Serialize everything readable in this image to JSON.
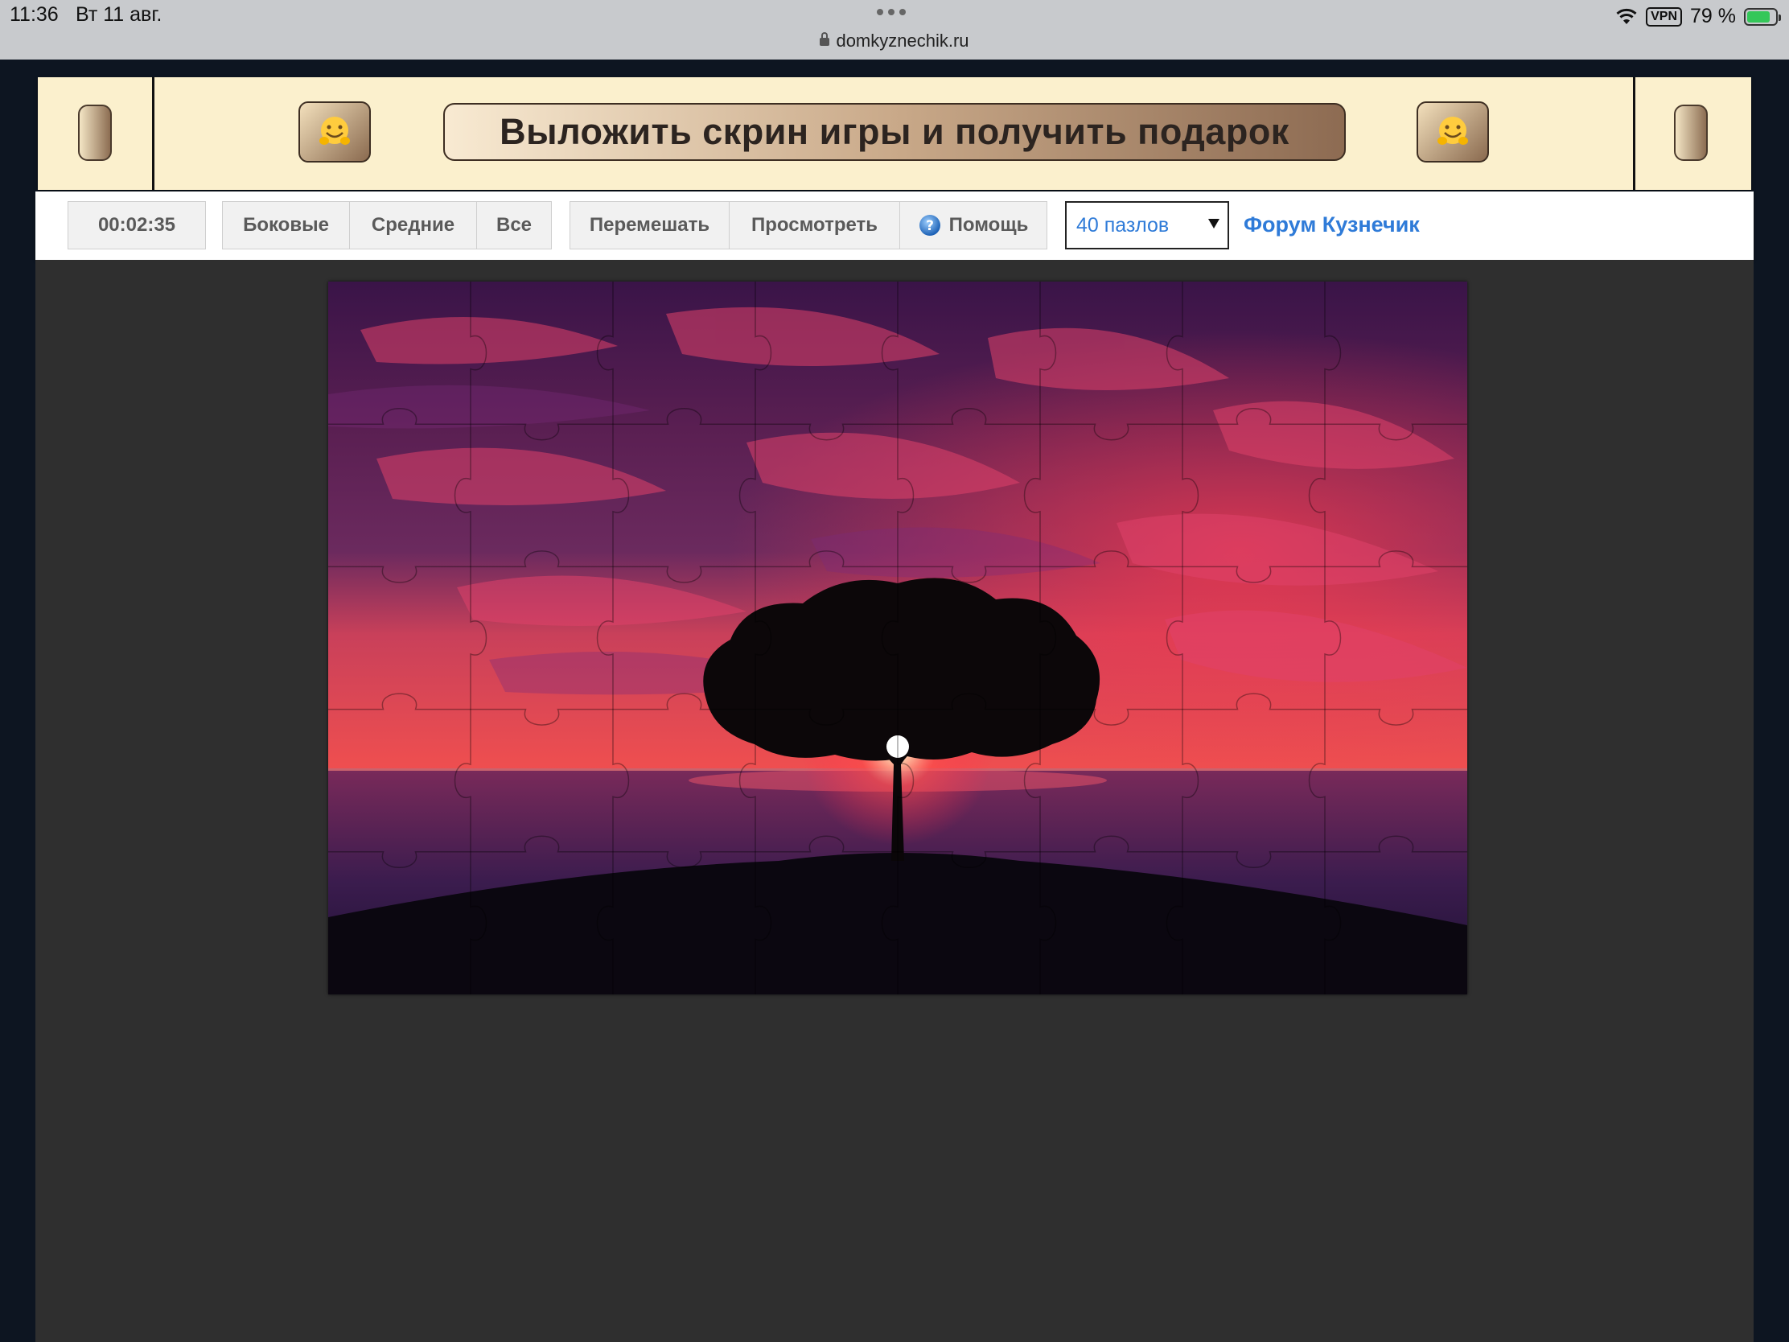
{
  "status_bar": {
    "time": "11:36",
    "date": "Вт 11 авг.",
    "url": "domkyznechik.ru",
    "vpn": "VPN",
    "battery": "79 %"
  },
  "banner": {
    "promo_label": "Выложить скрин игры и получить подарок",
    "emoji_icon": "hugging-face-icon"
  },
  "toolbar": {
    "timer": "00:02:35",
    "filters": [
      "Боковые",
      "Средние",
      "Все"
    ],
    "shuffle_label": "Перемешать",
    "preview_label": "Просмотреть",
    "help_label": "Помощь",
    "pieces_selected": "40 пазлов",
    "forum_link": "Форум Кузнечик"
  },
  "puzzle": {
    "pieces": 40,
    "columns": 8,
    "rows": 5
  },
  "colors": {
    "link": "#2f7bd8",
    "banner_bg": "#fbf0cd",
    "game_bg": "#2f2f2f"
  }
}
